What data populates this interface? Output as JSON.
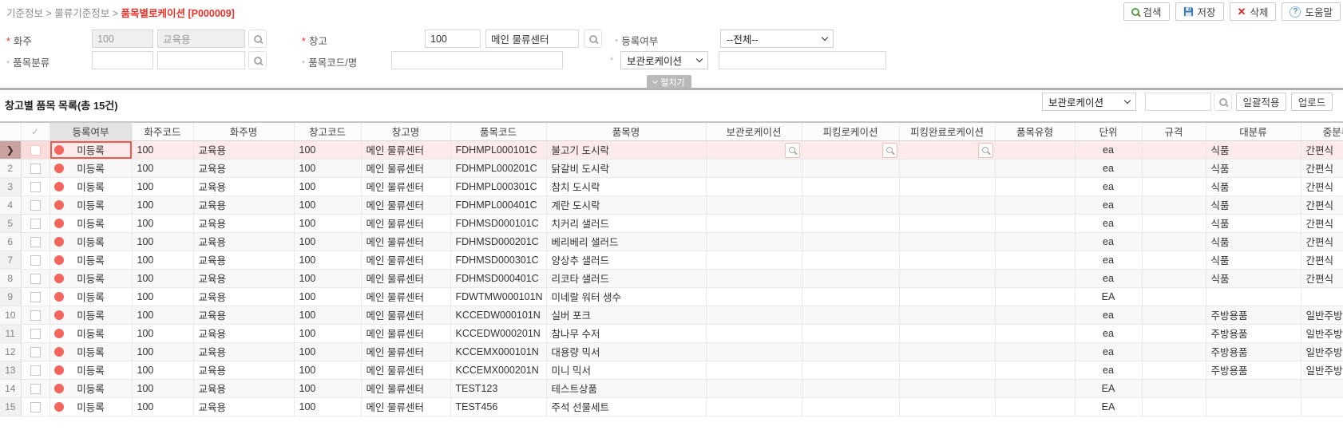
{
  "breadcrumb": {
    "path": "기준정보 > 물류기준정보 > ",
    "current": "품목별로케이션 [P000009]"
  },
  "icons": {
    "check": "✓",
    "delete_x": "✕",
    "help_q": "?",
    "row_pointer": "❯"
  },
  "top_buttons": {
    "search": "검색",
    "save": "저장",
    "delete": "삭제",
    "help": "도움말"
  },
  "form": {
    "shipper": {
      "label": "화주",
      "marker": "*",
      "code": "100",
      "name": "교육용"
    },
    "warehouse": {
      "label": "창고",
      "marker": "*",
      "code": "100",
      "name": "메인 물류센터"
    },
    "reg_status": {
      "label": "등록여부",
      "marker": "*",
      "value": "--전체--"
    },
    "item_class": {
      "label": "품목분류",
      "marker": "*",
      "code": "",
      "name": ""
    },
    "item_code_name": {
      "label": "품목코드/명",
      "marker": "*",
      "value": ""
    },
    "storage_loc": {
      "label": "보관로케이션",
      "marker": "*",
      "value": ""
    },
    "expand": "펼치기"
  },
  "grid": {
    "title": "창고별 품목 목록(총 15건)",
    "toolbar": {
      "location_select": "보관로케이션",
      "search_value": "",
      "apply": "일괄적용",
      "upload": "업로드"
    },
    "columns": [
      "등록여부",
      "화주코드",
      "화주명",
      "창고코드",
      "창고명",
      "품목코드",
      "품목명",
      "보관로케이션",
      "피킹로케이션",
      "피킹완료로케이션",
      "품목유형",
      "단위",
      "규격",
      "대분류",
      "중분류"
    ],
    "selected_row_index": 0,
    "rows": [
      [
        "미등록",
        "100",
        "교육용",
        "100",
        "메인 물류센터",
        "FDHMPL000101C",
        "불고기 도시락",
        "",
        "",
        "",
        "",
        "ea",
        "",
        "식품",
        "간편식"
      ],
      [
        "미등록",
        "100",
        "교육용",
        "100",
        "메인 물류센터",
        "FDHMPL000201C",
        "닭갈비 도시락",
        "",
        "",
        "",
        "",
        "ea",
        "",
        "식품",
        "간편식"
      ],
      [
        "미등록",
        "100",
        "교육용",
        "100",
        "메인 물류센터",
        "FDHMPL000301C",
        "참치 도시락",
        "",
        "",
        "",
        "",
        "ea",
        "",
        "식품",
        "간편식"
      ],
      [
        "미등록",
        "100",
        "교육용",
        "100",
        "메인 물류센터",
        "FDHMPL000401C",
        "계란 도시락",
        "",
        "",
        "",
        "",
        "ea",
        "",
        "식품",
        "간편식"
      ],
      [
        "미등록",
        "100",
        "교육용",
        "100",
        "메인 물류센터",
        "FDHMSD000101C",
        "치커리 샐러드",
        "",
        "",
        "",
        "",
        "ea",
        "",
        "식품",
        "간편식"
      ],
      [
        "미등록",
        "100",
        "교육용",
        "100",
        "메인 물류센터",
        "FDHMSD000201C",
        "베리베리 샐러드",
        "",
        "",
        "",
        "",
        "ea",
        "",
        "식품",
        "간편식"
      ],
      [
        "미등록",
        "100",
        "교육용",
        "100",
        "메인 물류센터",
        "FDHMSD000301C",
        "양상추 샐러드",
        "",
        "",
        "",
        "",
        "ea",
        "",
        "식품",
        "간편식"
      ],
      [
        "미등록",
        "100",
        "교육용",
        "100",
        "메인 물류센터",
        "FDHMSD000401C",
        "리코타 샐러드",
        "",
        "",
        "",
        "",
        "ea",
        "",
        "식품",
        "간편식"
      ],
      [
        "미등록",
        "100",
        "교육용",
        "100",
        "메인 물류센터",
        "FDWTMW000101N",
        "미네랄 워터 생수",
        "",
        "",
        "",
        "",
        "EA",
        "",
        "",
        ""
      ],
      [
        "미등록",
        "100",
        "교육용",
        "100",
        "메인 물류센터",
        "KCCEDW000101N",
        "실버 포크",
        "",
        "",
        "",
        "",
        "ea",
        "",
        "주방용품",
        "일반주방"
      ],
      [
        "미등록",
        "100",
        "교육용",
        "100",
        "메인 물류센터",
        "KCCEDW000201N",
        "참나무 수저",
        "",
        "",
        "",
        "",
        "ea",
        "",
        "주방용품",
        "일반주방"
      ],
      [
        "미등록",
        "100",
        "교육용",
        "100",
        "메인 물류센터",
        "KCCEMX000101N",
        "대용량 믹서",
        "",
        "",
        "",
        "",
        "ea",
        "",
        "주방용품",
        "일반주방"
      ],
      [
        "미등록",
        "100",
        "교육용",
        "100",
        "메인 물류센터",
        "KCCEMX000201N",
        "미니 믹서",
        "",
        "",
        "",
        "",
        "ea",
        "",
        "주방용품",
        "일반주방"
      ],
      [
        "미등록",
        "100",
        "교육용",
        "100",
        "메인 물류센터",
        "TEST123",
        "테스트상품",
        "",
        "",
        "",
        "",
        "EA",
        "",
        "",
        ""
      ],
      [
        "미등록",
        "100",
        "교육용",
        "100",
        "메인 물류센터",
        "TEST456",
        "주석 선물세트",
        "",
        "",
        "",
        "",
        "EA",
        "",
        "",
        ""
      ]
    ]
  },
  "colors": {
    "accent_red": "#e8332a",
    "status_dot": "#f4655e",
    "selected_row_bg": "#fdeaea",
    "focus_cell_border": "#ef5a4c",
    "header_highlight": "#e3e3e3"
  }
}
